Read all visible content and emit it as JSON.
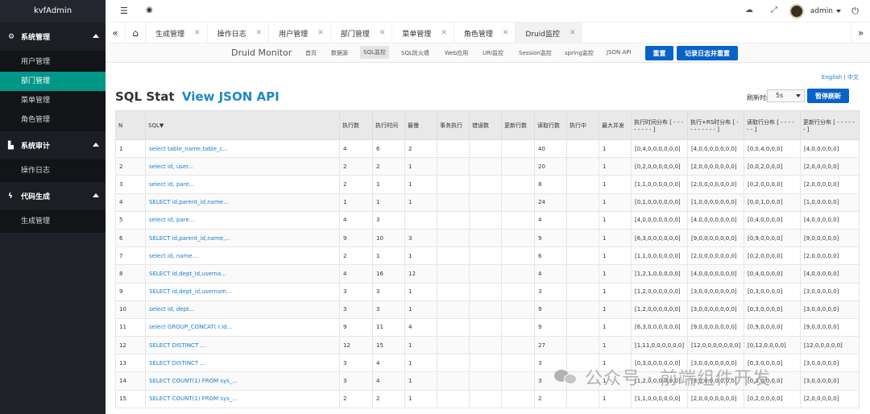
{
  "sidebar": {
    "brand": "kvfAdmin",
    "groups": [
      {
        "icon": "gears-icon",
        "label": "系统管理",
        "items": [
          "用户管理",
          "部门管理",
          "菜单管理",
          "角色管理"
        ]
      },
      {
        "icon": "chart-icon",
        "label": "系统审计",
        "items": [
          "操作日志"
        ]
      },
      {
        "icon": "bolt-icon",
        "label": "代码生成",
        "items": [
          "生成管理"
        ]
      }
    ],
    "active_item": "部门管理"
  },
  "header": {
    "user_name": "admin",
    "icons": [
      "menu-toggle-icon",
      "eye-icon",
      "skin-icon",
      "fullscreen-icon",
      "power-icon"
    ]
  },
  "tabs": {
    "items": [
      "生成管理",
      "操作日志",
      "用户管理",
      "部门管理",
      "菜单管理",
      "角色管理",
      "Druid监控"
    ],
    "active": "Druid监控",
    "prev": "«",
    "next": "»",
    "home_icon": "home-icon"
  },
  "druid": {
    "title": "Druid Monitor",
    "nav": [
      "首页",
      "数据源",
      "SQL监控",
      "SQL防火墙",
      "Web应用",
      "URI监控",
      "Session监控",
      "spring监控",
      "JSON API"
    ],
    "active_nav": "SQL监控",
    "reset_label": "重置",
    "log_reset_label": "记录日志并重置",
    "lang": "English | 中文",
    "stat_title": "SQL Stat",
    "stat_link": "View JSON API",
    "refresh_label": "刷新时间",
    "refresh_value": "5s",
    "stop_refresh_label": "暂停刷新"
  },
  "table": {
    "headers": [
      "N",
      "SQL▼",
      "执行数",
      "执行时间",
      "最慢",
      "事务执行",
      "错误数",
      "更新行数",
      "读取行数",
      "执行中",
      "最大并发",
      "执行时间分布 [ - - - - - - - - ]",
      "执行+RS时分布 [ - - - - - - - - ]",
      "读取行分布 [ - - - - - - ]",
      "更新行分布 [ - - - - - - ]"
    ],
    "rows": [
      [
        "1",
        "select table_name,table_c...",
        "4",
        "6",
        "2",
        "",
        "",
        "",
        "40",
        "",
        "1",
        "[0,4,0,0,0,0,0,0]",
        "[4,0,0,0,0,0,0,0]",
        "[0,0,4,0,0,0]",
        "[4,0,0,0,0,0]"
      ],
      [
        "2",
        "select id, user...",
        "2",
        "2",
        "1",
        "",
        "",
        "",
        "20",
        "",
        "1",
        "[0,2,0,0,0,0,0,0]",
        "[2,0,0,0,0,0,0,0]",
        "[0,0,2,0,0,0]",
        "[2,0,0,0,0,0]"
      ],
      [
        "3",
        "select id, pare...",
        "2",
        "1",
        "1",
        "",
        "",
        "",
        "8",
        "",
        "1",
        "[1,1,0,0,0,0,0,0]",
        "[2,0,0,0,0,0,0,0]",
        "[0,2,0,0,0,0]",
        "[2,0,0,0,0,0]"
      ],
      [
        "4",
        "SELECT id,parent_id,name...",
        "1",
        "1",
        "1",
        "",
        "",
        "",
        "24",
        "",
        "1",
        "[0,1,0,0,0,0,0,0]",
        "[1,0,0,0,0,0,0,0]",
        "[0,0,1,0,0,0]",
        "[1,0,0,0,0,0]"
      ],
      [
        "5",
        "select id, pare...",
        "4",
        "3",
        "",
        "",
        "",
        "",
        "4",
        "",
        "1",
        "[4,0,0,0,0,0,0,0]",
        "[4,0,0,0,0,0,0,0]",
        "[0,4,0,0,0,0]",
        "[4,0,0,0,0,0]"
      ],
      [
        "6",
        "SELECT id,parent_id,name,...",
        "9",
        "10",
        "3",
        "",
        "",
        "",
        "9",
        "",
        "1",
        "[6,3,0,0,0,0,0,0]",
        "[9,0,0,0,0,0,0,0]",
        "[0,9,0,0,0,0]",
        "[9,0,0,0,0,0]"
      ],
      [
        "7",
        "select id, name...",
        "2",
        "1",
        "1",
        "",
        "",
        "",
        "6",
        "",
        "1",
        "[1,1,0,0,0,0,0,0]",
        "[2,0,0,0,0,0,0,0]",
        "[0,2,0,0,0,0]",
        "[2,0,0,0,0,0]"
      ],
      [
        "8",
        "SELECT id,dept_id,userna...",
        "4",
        "16",
        "12",
        "",
        "",
        "",
        "4",
        "",
        "1",
        "[1,2,1,0,0,0,0,0]",
        "[4,0,0,0,0,0,0,0]",
        "[0,4,0,0,0,0]",
        "[4,0,0,0,0,0]"
      ],
      [
        "9",
        "SELECT id,dept_id,usernam...",
        "3",
        "3",
        "1",
        "",
        "",
        "",
        "3",
        "",
        "1",
        "[1,2,0,0,0,0,0,0]",
        "[3,0,0,0,0,0,0,0]",
        "[0,3,0,0,0,0]",
        "[3,0,0,0,0,0]"
      ],
      [
        "10",
        "select id, dept...",
        "3",
        "3",
        "1",
        "",
        "",
        "",
        "9",
        "",
        "1",
        "[1,2,0,0,0,0,0,0]",
        "[3,0,0,0,0,0,0,0]",
        "[0,3,0,0,0,0]",
        "[3,0,0,0,0,0]"
      ],
      [
        "11",
        "select GROUP_CONCAT( r.id...",
        "9",
        "11",
        "4",
        "",
        "",
        "",
        "9",
        "",
        "1",
        "[6,3,0,0,0,0,0,0]",
        "[9,0,0,0,0,0,0,0]",
        "[0,9,0,0,0,0]",
        "[9,0,0,0,0,0]"
      ],
      [
        "12",
        "SELECT DISTINCT ...",
        "12",
        "15",
        "1",
        "",
        "",
        "",
        "27",
        "",
        "1",
        "[1,11,0,0,0,0,0,0]",
        "[12,0,0,0,0,0,0,0]",
        "[0,12,0,0,0,0]",
        "[12,0,0,0,0,0]"
      ],
      [
        "13",
        "SELECT DISTINCT ...",
        "3",
        "4",
        "1",
        "",
        "",
        "",
        "3",
        "",
        "1",
        "[0,3,0,0,0,0,0,0]",
        "[3,0,0,0,0,0,0,0]",
        "[0,3,0,0,0,0]",
        "[3,0,0,0,0,0]"
      ],
      [
        "14",
        "SELECT COUNT(1) FROM sys_...",
        "3",
        "4",
        "1",
        "",
        "",
        "",
        "3",
        "",
        "1",
        "[1,2,0,0,0,0,0,0]",
        "[3,0,0,0,0,0,0,0]",
        "[0,3,0,0,0,0]",
        "[3,0,0,0,0,0]"
      ],
      [
        "15",
        "SELECT COUNT(1) FROM sys_...",
        "2",
        "2",
        "1",
        "",
        "",
        "",
        "2",
        "",
        "1",
        "[1,1,0,0,0,0,0,0]",
        "[2,0,0,0,0,0,0,0]",
        "[0,2,0,0,0,0]",
        "[2,0,0,0,0,0]"
      ]
    ]
  },
  "watermark": {
    "text": "公众号 · 前端组件开发",
    "icon": "wechat-icon"
  },
  "colors": {
    "sidebar_bg": "#20222a",
    "active_teal": "#009688",
    "button_blue": "#0862c8",
    "link_blue": "#1a7bd0"
  }
}
